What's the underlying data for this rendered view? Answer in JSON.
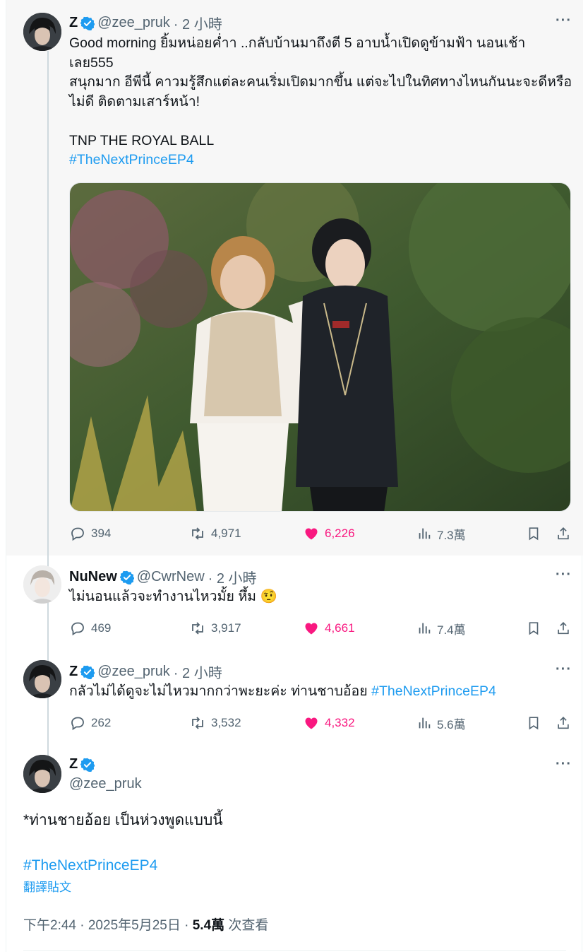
{
  "tweets": [
    {
      "name": "Z",
      "handle": "@zee_pruk",
      "time": "· 2 小時",
      "lines": [
        "Good morning ยิ้มหน่อยค่ำา ..กลับบ้านมาถึงตี 5 อาบน้ำเปิดดูข้ามฟ้า นอนเช้า",
        "เลย555",
        "สนุกมาก อีพีนี้ คาวมรู้สึกแต่ละคนเริ่มเปิดมากขึ้น แต่จะไปในทิศทางไหนกันนะจะดีหรือ",
        "ไม่ดี ติดตามเสาร์หน้า!",
        "",
        "TNP THE ROYAL BALL"
      ],
      "hashtag": "#TheNextPrinceEP4",
      "replies": "394",
      "reposts": "4,971",
      "likes": "6,226",
      "views": "7.3萬"
    },
    {
      "name": "NuNew",
      "handle": "@CwrNew",
      "time": "· 2 小時",
      "text": "ไม่นอนแล้วจะทำงานไหวมั้ย หึ้ม 🤨",
      "replies": "469",
      "reposts": "3,917",
      "likes": "4,661",
      "views": "7.4萬"
    },
    {
      "name": "Z",
      "handle": "@zee_pruk",
      "time": "· 2 小時",
      "text": "กลัวไม่ได้ดูจะไม่ไหวมากกว่าพะยะค่ะ ท่านชาบอ้อย ",
      "hashtag": "#TheNextPrinceEP4",
      "replies": "262",
      "reposts": "3,532",
      "likes": "4,332",
      "views": "5.6萬"
    }
  ],
  "main": {
    "name": "Z",
    "handle": "@zee_pruk",
    "text": "*ท่านชายอ้อย เป็นห่วงพูดแบบนี้",
    "hashtag": "#TheNextPrinceEP4",
    "translate": "翻譯貼文",
    "time": "下午2:44 · 2025年5月25日 · ",
    "view_count": "5.4萬",
    "view_label": " 次查看"
  },
  "more_glyph": "···",
  "colors": {
    "accent": "#1d9bf0",
    "like": "#f91880",
    "muted": "#536471"
  },
  "icons": [
    "verified-badge-icon",
    "reply-icon",
    "repost-icon",
    "like-icon",
    "views-icon",
    "bookmark-icon",
    "share-icon",
    "more-icon"
  ]
}
